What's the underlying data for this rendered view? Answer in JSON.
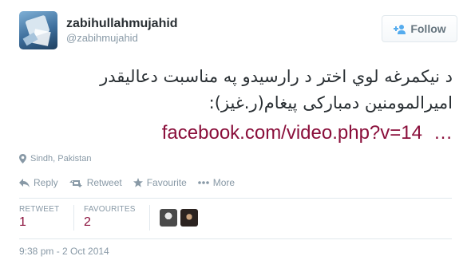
{
  "user": {
    "display_name": "zabihullahmujahid",
    "screen_name": "@zabihmujahid"
  },
  "follow_button": {
    "label": "Follow"
  },
  "tweet": {
    "text_line1": "د نیکمرغه لوي اختر د رارسیدو په مناسبت دعالیقدر",
    "text_line2": "امیرالمومنین دمبارکی پیغام(ر.غیز):",
    "link": "facebook.com/video.php?v=14",
    "ellipsis": "…"
  },
  "location": "Sindh, Pakistan",
  "actions": {
    "reply": "Reply",
    "retweet": "Retweet",
    "favourite": "Favourite",
    "more": "More"
  },
  "stats": {
    "retweets_label": "RETWEET",
    "retweets_value": "1",
    "favourites_label": "FAVOURITES",
    "favourites_value": "2"
  },
  "timestamp": "9:38 pm - 2 Oct 2014",
  "colors": {
    "link": "#8a0f3b",
    "muted": "#8899a6",
    "text": "#292f33"
  },
  "icons": {
    "follow": "person-plus-icon",
    "location": "pin-icon",
    "reply": "reply-arrow-icon",
    "retweet": "retweet-icon",
    "favourite": "star-icon",
    "more": "ellipsis-icon"
  }
}
